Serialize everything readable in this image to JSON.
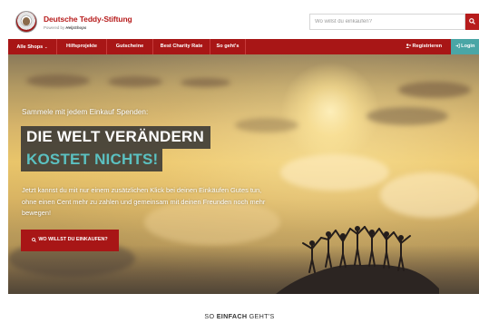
{
  "brand": {
    "name": "Deutsche Teddy-Stiftung",
    "powered_prefix": "Powered by",
    "powered_name": "HelpShops"
  },
  "search": {
    "placeholder": "Wo willst du einkaufen?",
    "button_icon": "search-icon"
  },
  "nav": {
    "items": [
      {
        "label": "Alle Shops",
        "icon": "chevron-down-icon"
      },
      {
        "label": "Hilfsprojekte"
      },
      {
        "label": "Gutscheine"
      },
      {
        "label": "Best Charity Rate"
      },
      {
        "label": "So geht's"
      }
    ],
    "register": {
      "label": "Registrieren",
      "icon": "user-plus-icon"
    },
    "login": {
      "label": "Login",
      "icon": "login-icon"
    }
  },
  "hero": {
    "tagline": "Sammele mit jedem Einkauf Spenden:",
    "headline_line1": "DIE WELT VERÄNDERN",
    "headline_line2": "KOSTET NICHTS!",
    "body": "Jetzt kannst du mit nur einem zusätzlichen Klick bei deinen Einkäufen Gutes tun, ohne einen Cent mehr zu zahlen und gemeinsam mit deinen Freunden noch mehr bewegen!",
    "cta_label": "WO WILLST DU EINKAUFEN?",
    "cta_icon": "search-icon"
  },
  "section": {
    "title_prefix": "SO ",
    "title_bold": "EINFACH",
    "title_suffix": " GEHT'S"
  },
  "colors": {
    "brand_red": "#a81616",
    "accent_teal": "#4aa6a6",
    "headline_teal": "#5bc1c1"
  }
}
